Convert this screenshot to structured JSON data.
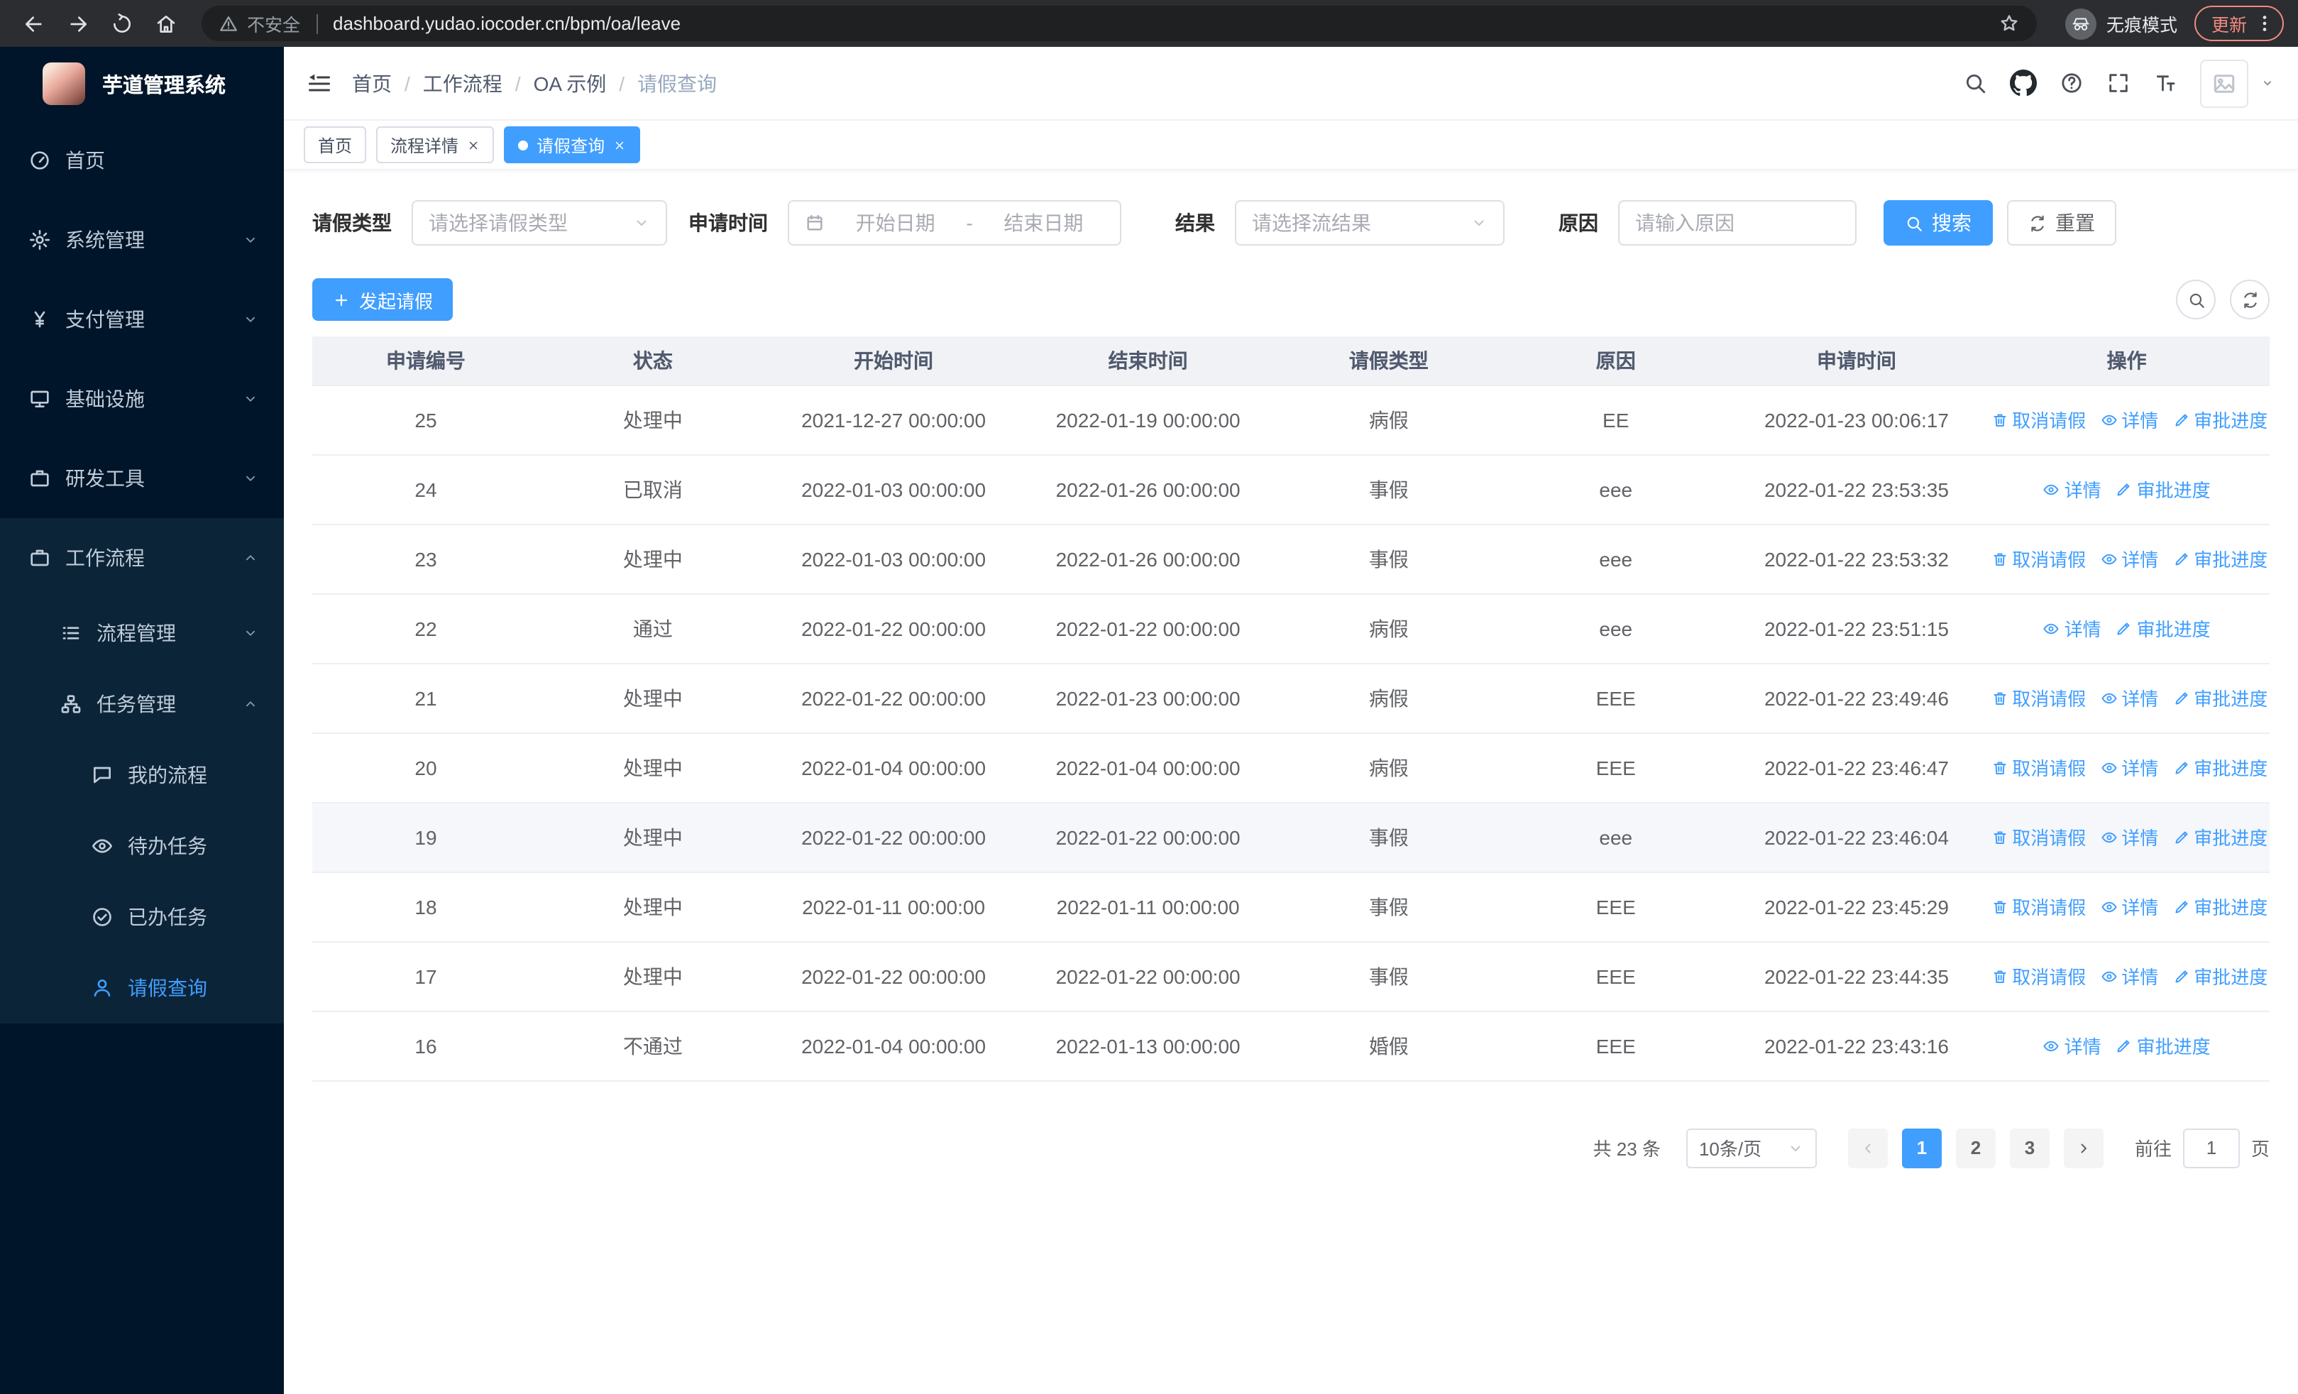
{
  "browser": {
    "security_warning": "不安全",
    "url": "dashboard.yudao.iocoder.cn/bpm/oa/leave",
    "incognito_label": "无痕模式",
    "update_label": "更新"
  },
  "sidebar": {
    "logo_title": "芋道管理系统",
    "menu": [
      {
        "label": "首页",
        "icon": "dashboard",
        "level": 1
      },
      {
        "label": "系统管理",
        "icon": "gear",
        "level": 1,
        "chevron": "down"
      },
      {
        "label": "支付管理",
        "icon": "yen",
        "level": 1,
        "chevron": "down"
      },
      {
        "label": "基础设施",
        "icon": "infra",
        "level": 1,
        "chevron": "down"
      },
      {
        "label": "研发工具",
        "icon": "briefcase",
        "level": 1,
        "chevron": "down"
      },
      {
        "label": "工作流程",
        "icon": "briefcase",
        "level": 1,
        "chevron": "up",
        "section": true
      },
      {
        "label": "流程管理",
        "icon": "list",
        "level": 2,
        "chevron": "down",
        "section": true
      },
      {
        "label": "任务管理",
        "icon": "flow",
        "level": 2,
        "chevron": "up",
        "section": true
      },
      {
        "label": "我的流程",
        "icon": "chat",
        "level": 3,
        "section": true
      },
      {
        "label": "待办任务",
        "icon": "eye",
        "level": 3,
        "section": true
      },
      {
        "label": "已办任务",
        "icon": "check",
        "level": 3,
        "section": true
      },
      {
        "label": "请假查询",
        "icon": "user",
        "level": 3,
        "section": true,
        "active": true
      }
    ]
  },
  "header": {
    "breadcrumb": [
      "首页",
      "工作流程",
      "OA 示例",
      "请假查询"
    ]
  },
  "tabs": [
    {
      "label": "首页",
      "closable": false,
      "active": false
    },
    {
      "label": "流程详情",
      "closable": true,
      "active": false
    },
    {
      "label": "请假查询",
      "closable": true,
      "active": true
    }
  ],
  "filters": {
    "leave_type_label": "请假类型",
    "leave_type_placeholder": "请选择请假类型",
    "apply_time_label": "申请时间",
    "start_date_placeholder": "开始日期",
    "range_separator": "-",
    "end_date_placeholder": "结束日期",
    "result_label": "结果",
    "result_placeholder": "请选择流结果",
    "reason_label": "原因",
    "reason_placeholder": "请输入原因",
    "search_label": "搜索",
    "reset_label": "重置"
  },
  "toolbar": {
    "create_label": "发起请假"
  },
  "table": {
    "columns": [
      "申请编号",
      "状态",
      "开始时间",
      "结束时间",
      "请假类型",
      "原因",
      "申请时间",
      "操作"
    ],
    "actions": {
      "cancel": "取消请假",
      "detail": "详情",
      "progress": "审批进度"
    },
    "rows": [
      {
        "id": "25",
        "status": "处理中",
        "start": "2021-12-27 00:00:00",
        "end": "2022-01-19 00:00:00",
        "type": "病假",
        "reason": "EE",
        "applied": "2022-01-23 00:06:17",
        "cancellable": true,
        "highlight": false
      },
      {
        "id": "24",
        "status": "已取消",
        "start": "2022-01-03 00:00:00",
        "end": "2022-01-26 00:00:00",
        "type": "事假",
        "reason": "eee",
        "applied": "2022-01-22 23:53:35",
        "cancellable": false,
        "highlight": false
      },
      {
        "id": "23",
        "status": "处理中",
        "start": "2022-01-03 00:00:00",
        "end": "2022-01-26 00:00:00",
        "type": "事假",
        "reason": "eee",
        "applied": "2022-01-22 23:53:32",
        "cancellable": true,
        "highlight": false
      },
      {
        "id": "22",
        "status": "通过",
        "start": "2022-01-22 00:00:00",
        "end": "2022-01-22 00:00:00",
        "type": "病假",
        "reason": "eee",
        "applied": "2022-01-22 23:51:15",
        "cancellable": false,
        "highlight": false
      },
      {
        "id": "21",
        "status": "处理中",
        "start": "2022-01-22 00:00:00",
        "end": "2022-01-23 00:00:00",
        "type": "病假",
        "reason": "EEE",
        "applied": "2022-01-22 23:49:46",
        "cancellable": true,
        "highlight": false
      },
      {
        "id": "20",
        "status": "处理中",
        "start": "2022-01-04 00:00:00",
        "end": "2022-01-04 00:00:00",
        "type": "病假",
        "reason": "EEE",
        "applied": "2022-01-22 23:46:47",
        "cancellable": true,
        "highlight": false
      },
      {
        "id": "19",
        "status": "处理中",
        "start": "2022-01-22 00:00:00",
        "end": "2022-01-22 00:00:00",
        "type": "事假",
        "reason": "eee",
        "applied": "2022-01-22 23:46:04",
        "cancellable": true,
        "highlight": true
      },
      {
        "id": "18",
        "status": "处理中",
        "start": "2022-01-11 00:00:00",
        "end": "2022-01-11 00:00:00",
        "type": "事假",
        "reason": "EEE",
        "applied": "2022-01-22 23:45:29",
        "cancellable": true,
        "highlight": false
      },
      {
        "id": "17",
        "status": "处理中",
        "start": "2022-01-22 00:00:00",
        "end": "2022-01-22 00:00:00",
        "type": "事假",
        "reason": "EEE",
        "applied": "2022-01-22 23:44:35",
        "cancellable": true,
        "highlight": false
      },
      {
        "id": "16",
        "status": "不通过",
        "start": "2022-01-04 00:00:00",
        "end": "2022-01-13 00:00:00",
        "type": "婚假",
        "reason": "EEE",
        "applied": "2022-01-22 23:43:16",
        "cancellable": false,
        "highlight": false
      }
    ]
  },
  "pagination": {
    "total_label": "共 23 条",
    "page_size": "10条/页",
    "pages": [
      "1",
      "2",
      "3"
    ],
    "current_page": "1",
    "goto_label": "前往",
    "goto_value": "1",
    "page_suffix": "页"
  },
  "colors": {
    "accent": "#409eff",
    "sidebar_bg": "#001529",
    "submenu_bg": "#0c2438",
    "update": "#f28b82"
  }
}
